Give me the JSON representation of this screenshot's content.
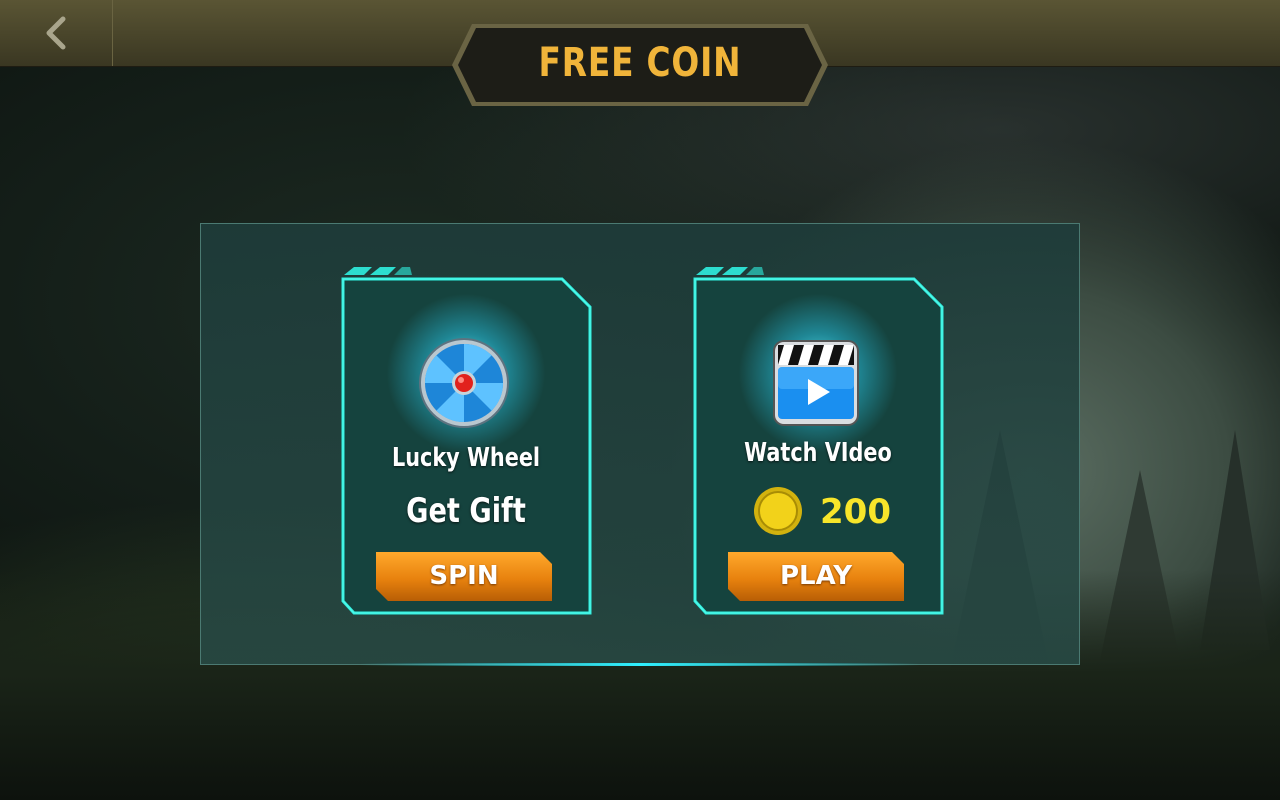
{
  "header": {
    "title": "FREE COIN",
    "back_icon": "chevron-left-icon"
  },
  "cards": [
    {
      "icon": "lucky-wheel-icon",
      "title": "Lucky Wheel",
      "subtitle": "Get Gift",
      "button_label": "SPIN"
    },
    {
      "icon": "video-clapper-play-icon",
      "title": "Watch VIdeo",
      "reward_icon": "gold-coin-icon",
      "reward_amount": "200",
      "button_label": "PLAY"
    }
  ],
  "colors": {
    "title_gold": "#f0b43a",
    "frame_cyan": "#2ff0e0",
    "button_orange": "#e8820e",
    "coin_yellow": "#f7e52a"
  }
}
